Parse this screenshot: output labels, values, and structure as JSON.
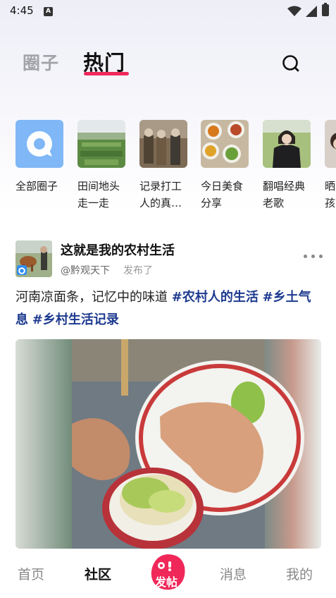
{
  "status_bar": {
    "time": "4:45",
    "notification_icon_letter": "A"
  },
  "header": {
    "tabs": [
      {
        "label": "圈子",
        "active": false
      },
      {
        "label": "热门",
        "active": true
      }
    ],
    "accent_color": "#f0285a"
  },
  "circles": [
    {
      "label": "全部圈子",
      "icon": "chat-bubble-icon"
    },
    {
      "label": "田间地头走一走"
    },
    {
      "label": "记录打工人的真…"
    },
    {
      "label": "今日美食分享"
    },
    {
      "label": "翻唱经典老歌"
    },
    {
      "label": "晒孩"
    }
  ],
  "post": {
    "title": "这就是我的农村生活",
    "author": "@黔观天下",
    "action": "发布了",
    "text": "河南凉面条，记忆中的味道 ",
    "tags": [
      "#农村人的生活",
      "#乡土气息",
      "#乡村生活记录"
    ]
  },
  "bottom_nav": {
    "items": [
      {
        "label": "首页",
        "active": false
      },
      {
        "label": "社区",
        "active": true
      },
      {
        "label": "发帖",
        "active": false
      },
      {
        "label": "消息",
        "active": false
      },
      {
        "label": "我的",
        "active": false
      }
    ]
  }
}
